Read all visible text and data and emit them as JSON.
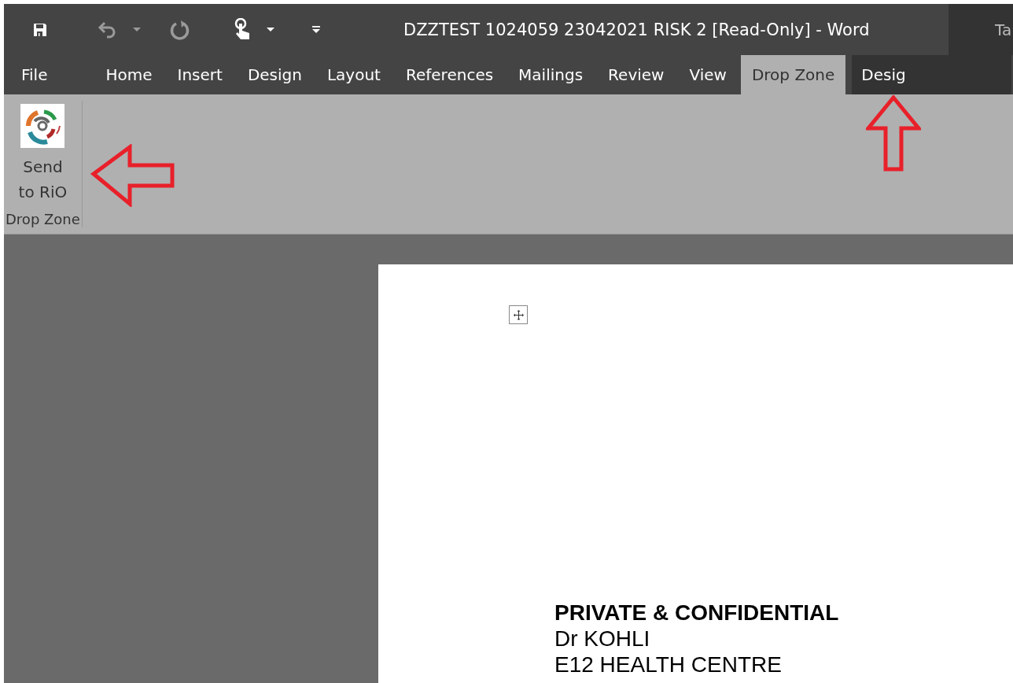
{
  "window": {
    "title": "DZZTEST 1024059 23042021 RISK 2 [Read-Only] - Word",
    "contextual_title": "Ta"
  },
  "tabs": [
    {
      "label": "File",
      "selected": false,
      "kind": "normal"
    },
    {
      "label": "Home",
      "selected": false,
      "kind": "normal"
    },
    {
      "label": "Insert",
      "selected": false,
      "kind": "normal"
    },
    {
      "label": "Design",
      "selected": false,
      "kind": "normal"
    },
    {
      "label": "Layout",
      "selected": false,
      "kind": "normal"
    },
    {
      "label": "References",
      "selected": false,
      "kind": "normal"
    },
    {
      "label": "Mailings",
      "selected": false,
      "kind": "normal"
    },
    {
      "label": "Review",
      "selected": false,
      "kind": "normal"
    },
    {
      "label": "View",
      "selected": false,
      "kind": "normal"
    },
    {
      "label": "Drop Zone",
      "selected": true,
      "kind": "normal"
    },
    {
      "label": "Desig",
      "selected": false,
      "kind": "contextual"
    }
  ],
  "ribbon": {
    "groups": [
      {
        "label": "Drop Zone",
        "buttons": [
          {
            "label": "Send\nto RiO"
          }
        ]
      }
    ]
  },
  "document": {
    "lines": [
      {
        "text": "PRIVATE & CONFIDENTIAL",
        "bold": true
      },
      {
        "text": "Dr KOHLI",
        "bold": false
      },
      {
        "text": "E12 HEALTH CENTRE",
        "bold": false
      }
    ]
  }
}
